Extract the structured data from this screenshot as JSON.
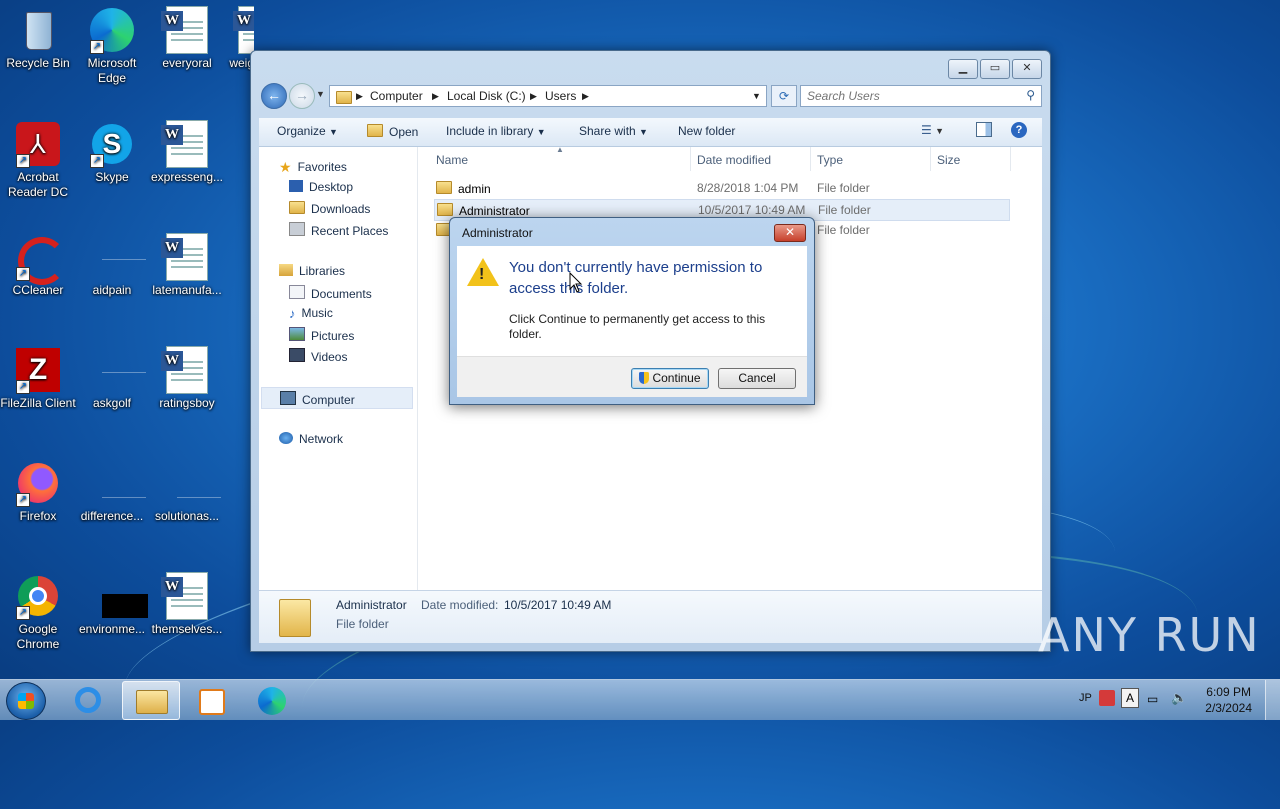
{
  "desktop": {
    "icons": [
      {
        "label": "Recycle Bin",
        "icon": "recycle-bin-icon"
      },
      {
        "label": "Microsoft Edge",
        "icon": "edge-icon"
      },
      {
        "label": "everyoral",
        "icon": "word-doc-icon"
      },
      {
        "label": "weig",
        "icon": "word-doc-icon"
      },
      {
        "label": "Acrobat Reader DC",
        "icon": "acrobat-icon"
      },
      {
        "label": "Skype",
        "icon": "skype-icon"
      },
      {
        "label": "expresseng...",
        "icon": "word-doc-icon"
      },
      {
        "label": "CCleaner",
        "icon": "ccleaner-icon"
      },
      {
        "label": "aidpain",
        "icon": "blank-file-icon"
      },
      {
        "label": "latemanufa...",
        "icon": "word-doc-icon"
      },
      {
        "label": "FileZilla Client",
        "icon": "filezilla-icon"
      },
      {
        "label": "askgolf",
        "icon": "blank-file-icon"
      },
      {
        "label": "ratingsboy",
        "icon": "word-doc-icon"
      },
      {
        "label": "Firefox",
        "icon": "firefox-icon"
      },
      {
        "label": "difference...",
        "icon": "blank-file-icon"
      },
      {
        "label": "solutionas...",
        "icon": "blank-file-icon"
      },
      {
        "label": "Google Chrome",
        "icon": "chrome-icon"
      },
      {
        "label": "environme...",
        "icon": "black-file-icon"
      },
      {
        "label": "themselves...",
        "icon": "word-doc-icon"
      }
    ]
  },
  "explorer": {
    "address": {
      "segments": [
        "Computer",
        "Local Disk (C:)",
        "Users"
      ]
    },
    "search_placeholder": "Search Users",
    "toolbar": {
      "organize": "Organize",
      "open": "Open",
      "include": "Include in library",
      "share": "Share with",
      "new_folder": "New folder"
    },
    "nav": {
      "favorites": "Favorites",
      "desktop": "Desktop",
      "downloads": "Downloads",
      "recent": "Recent Places",
      "libraries": "Libraries",
      "documents": "Documents",
      "music": "Music",
      "pictures": "Pictures",
      "videos": "Videos",
      "computer": "Computer",
      "network": "Network"
    },
    "columns": {
      "name": "Name",
      "date": "Date modified",
      "type": "Type",
      "size": "Size"
    },
    "files": [
      {
        "name": "admin",
        "date": "8/28/2018 1:04 PM",
        "type": "File folder"
      },
      {
        "name": "Administrator",
        "date": "10/5/2017 10:49 AM",
        "type": "File folder"
      },
      {
        "name": "",
        "date": "",
        "type": "File folder"
      }
    ],
    "details": {
      "name": "Administrator",
      "date_label": "Date modified:",
      "date_value": "10/5/2017 10:49 AM",
      "type": "File folder"
    }
  },
  "dialog": {
    "title": "Administrator",
    "close": "✕",
    "heading": "You don't currently have permission to access this folder.",
    "body": "Click Continue to permanently get access to this folder.",
    "continue": "Continue",
    "cancel": "Cancel"
  },
  "tray": {
    "lang": "JP",
    "ime": "A",
    "time": "6:09 PM",
    "date": "2/3/2024"
  },
  "watermark": "ANY RUN"
}
